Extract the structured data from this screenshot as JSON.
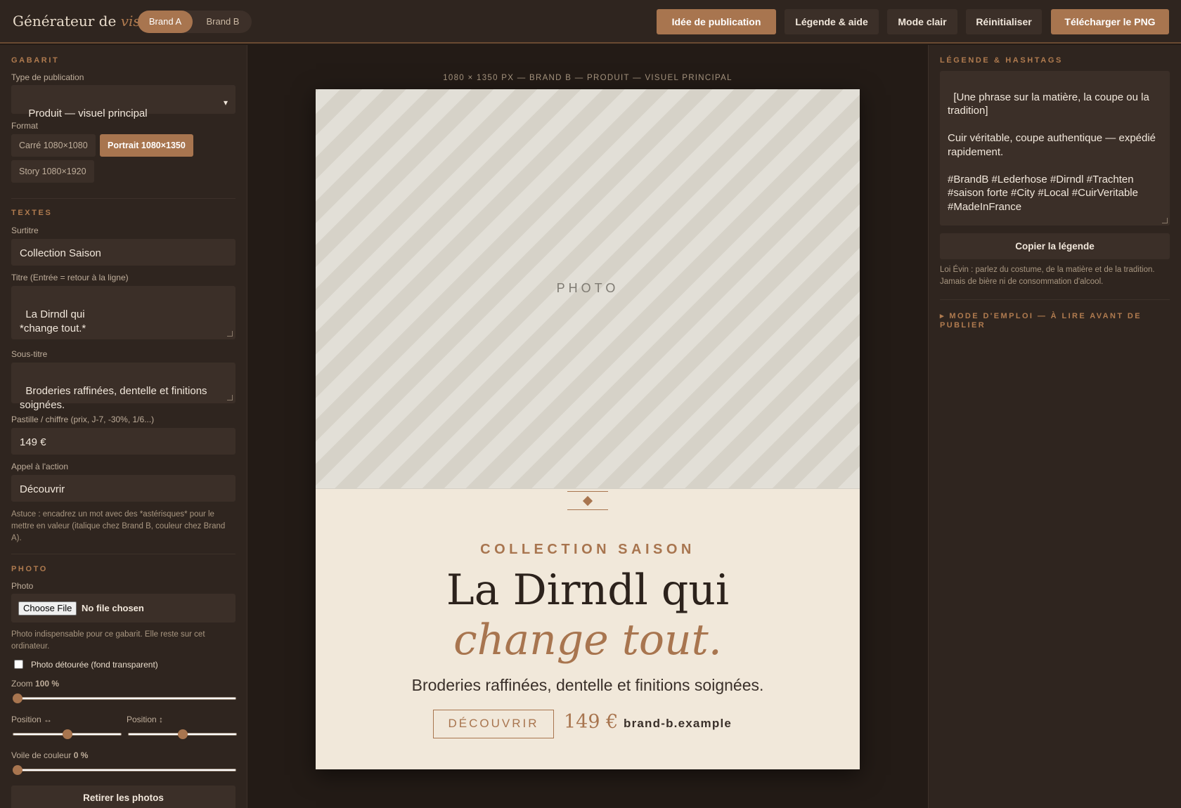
{
  "header": {
    "title_main": "Générateur de",
    "title_em": "visuels",
    "brands": [
      "Brand A",
      "Brand B"
    ],
    "buttons": {
      "idea": "Idée de publication",
      "caption_help": "Légende & aide",
      "light_mode": "Mode clair",
      "reset": "Réinitialiser",
      "download": "Télécharger le PNG"
    }
  },
  "left": {
    "gabarit": {
      "section": "GABARIT",
      "type_label": "Type de publication",
      "type_value": "Produit — visuel principal",
      "format_label": "Format",
      "formats": [
        "Carré 1080×1080",
        "Portrait 1080×1350",
        "Story 1080×1920"
      ],
      "selected_format": "Portrait 1080×1350"
    },
    "textes": {
      "section": "TEXTES",
      "surtitre_label": "Surtitre",
      "surtitre_value": "Collection Saison",
      "titre_label": "Titre (Entrée = retour à la ligne)",
      "titre_value": "La Dirndl qui\n*change tout.*",
      "soustitre_label": "Sous-titre",
      "soustitre_value": "Broderies raffinées, dentelle et finitions soignées.",
      "pastille_label": "Pastille / chiffre (prix, J-7, -30%, 1/6...)",
      "pastille_value": "149 €",
      "cta_label": "Appel à l'action",
      "cta_value": "Découvrir",
      "tip": "Astuce : encadrez un mot avec des *astérisques* pour le mettre en valeur (italique chez Brand B, couleur chez Brand A)."
    },
    "photo": {
      "section": "PHOTO",
      "photo_label": "Photo",
      "file_button": "Choose File",
      "file_status": "No file chosen",
      "note": "Photo indispensable pour ce gabarit. Elle reste sur cet ordinateur.",
      "cutout_label": "Photo détourée (fond transparent)",
      "cutout_checked": false,
      "zoom_label": "Zoom",
      "zoom_value": "100 %",
      "zoom_level": 0,
      "pos_h_label": "Position ↔",
      "pos_h_level": 0.5,
      "pos_v_label": "Position ↕",
      "pos_v_level": 0.5,
      "veil_label": "Voile de couleur",
      "veil_value": "0 %",
      "veil_level": 0,
      "remove_button": "Retirer les photos"
    }
  },
  "canvas": {
    "info": "1080 × 1350 PX — BRAND B — PRODUIT — VISUEL PRINCIPAL",
    "photo_placeholder": "PHOTO",
    "kicker": "COLLECTION SAISON",
    "headline_line1": "La Dirndl qui",
    "headline_line2": "change tout.",
    "subline": "Broderies raffinées, dentelle et finitions soignées.",
    "cta": "DÉCOUVRIR",
    "price": "149 €",
    "site": "brand-b.example"
  },
  "right": {
    "section": "LÉGENDE & HASHTAGS",
    "caption": "[Une phrase sur la matière, la coupe ou la tradition]\n\nCuir véritable, coupe authentique — expédié rapidement.\n\n#BrandB #Lederhose #Dirndl #Trachten #saison forte #City #Local #CuirVeritable #MadeInFrance",
    "copy_button": "Copier la légende",
    "legal": "Loi Évin : parlez du costume, de la matière et de la tradition. Jamais de bière ni de consommation d'alcool.",
    "howto": "MODE D'EMPLOI — À LIRE AVANT DE PUBLIER"
  },
  "colors": {
    "accent": "#a8754f",
    "panel": "#2f251f",
    "background": "#231b16",
    "cream": "#f1e8da"
  }
}
